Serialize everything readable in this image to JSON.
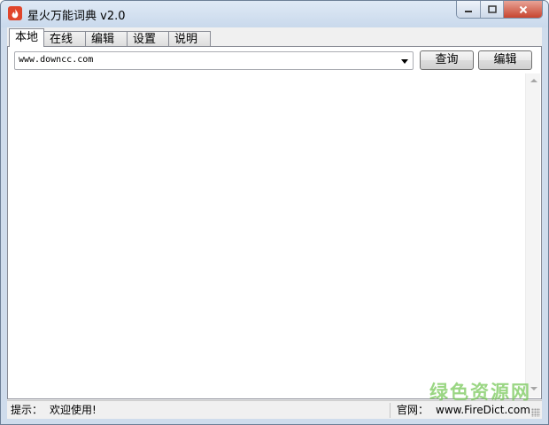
{
  "window": {
    "title": "星火万能词典 v2.0"
  },
  "tabs": [
    {
      "label": "本地",
      "active": true
    },
    {
      "label": "在线",
      "active": false
    },
    {
      "label": "编辑",
      "active": false
    },
    {
      "label": "设置",
      "active": false
    },
    {
      "label": "说明",
      "active": false
    }
  ],
  "search": {
    "value": "www.downcc.com"
  },
  "toolbar": {
    "query_label": "查询",
    "edit_label": "编辑"
  },
  "statusbar": {
    "hint_label": "提示：",
    "hint_text": "欢迎使用!",
    "site_label": "官网：",
    "site_url": "www.FireDict.com"
  },
  "watermark": "绿色资源网",
  "colors": {
    "title_bar": "#cfdcec",
    "close_button": "#c7452f",
    "app_icon": "#e0452b",
    "watermark": "#78c85a"
  },
  "icons": {
    "app": "fire-drop-icon",
    "minimize": "minimize-icon",
    "maximize": "maximize-icon",
    "close": "close-icon",
    "dropdown": "chevron-down-icon"
  }
}
